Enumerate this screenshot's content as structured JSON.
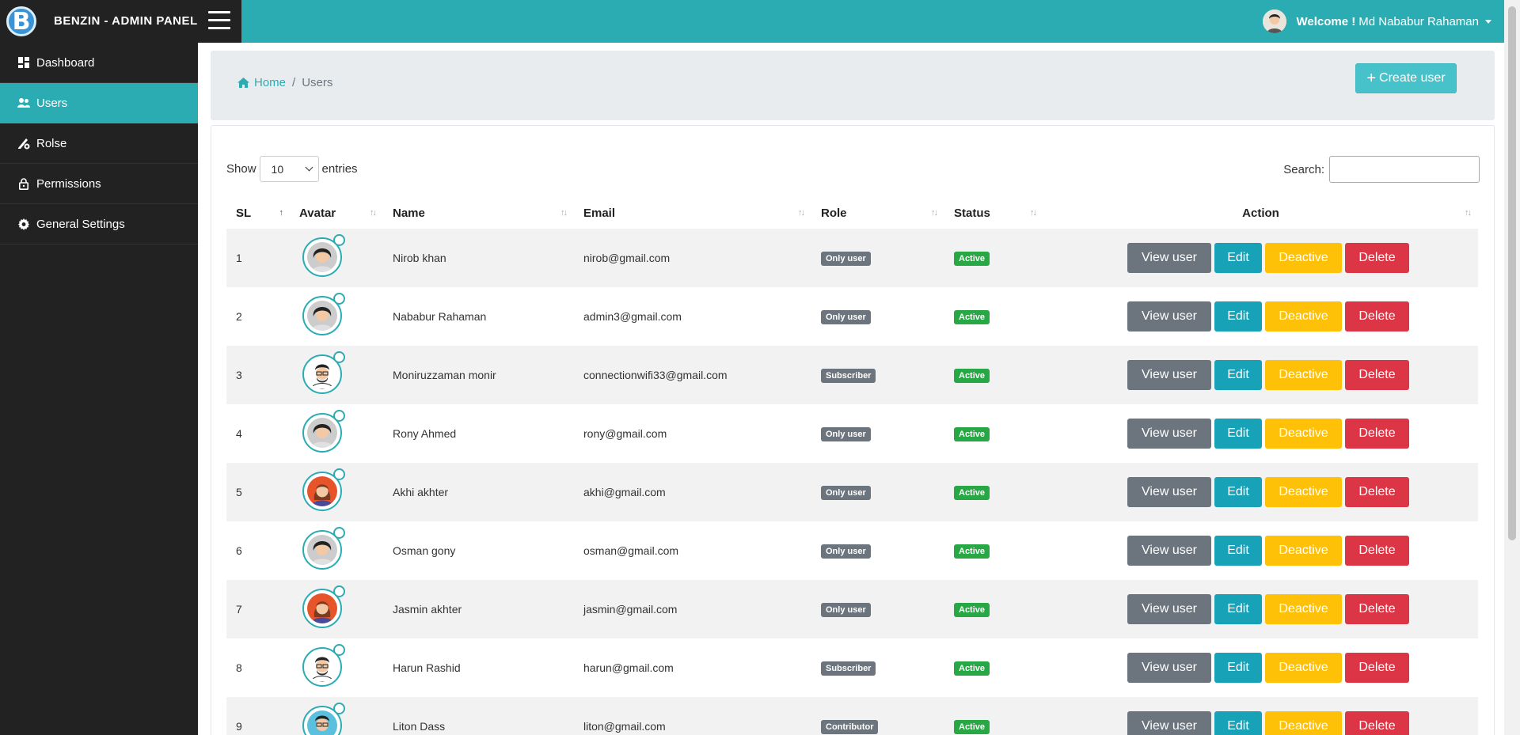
{
  "brand": {
    "logo_letter": "B",
    "title": "BENZIN - ADMIN PANEL"
  },
  "header": {
    "welcome_label": "Welcome !",
    "user_name": "Md Nababur Rahaman"
  },
  "sidebar": {
    "items": [
      {
        "label": "Dashboard",
        "icon": "dashboard-icon",
        "active": false
      },
      {
        "label": "Users",
        "icon": "users-icon",
        "active": true
      },
      {
        "label": "Rolse",
        "icon": "roles-icon",
        "active": false
      },
      {
        "label": "Permissions",
        "icon": "lock-icon",
        "active": false
      },
      {
        "label": "General Settings",
        "icon": "gear-icon",
        "active": false
      }
    ]
  },
  "breadcrumb": {
    "home": "Home",
    "separator": "/",
    "current": "Users"
  },
  "create_button": {
    "label": "Create user"
  },
  "table_controls": {
    "show_label": "Show",
    "entries_value": "10",
    "entries_label": "entries",
    "search_label": "Search:",
    "search_value": ""
  },
  "columns": [
    "SL",
    "Avatar",
    "Name",
    "Email",
    "Role",
    "Status",
    "Action"
  ],
  "actions": {
    "view": "View user",
    "edit": "Edit",
    "deactive": "Deactive",
    "delete": "Delete"
  },
  "rows": [
    {
      "sl": "1",
      "avatar": "male-dark",
      "name": "Nirob khan",
      "email": "nirob@gmail.com",
      "role": "Only user",
      "status": "Active"
    },
    {
      "sl": "2",
      "avatar": "male-dark",
      "name": "Nababur Rahaman",
      "email": "admin3@gmail.com",
      "role": "Only user",
      "status": "Active"
    },
    {
      "sl": "3",
      "avatar": "male-glasses",
      "name": "Moniruzzaman monir",
      "email": "connectionwifi33@gmail.com",
      "role": "Subscriber",
      "status": "Active"
    },
    {
      "sl": "4",
      "avatar": "male-dark",
      "name": "Rony Ahmed",
      "email": "rony@gmail.com",
      "role": "Only user",
      "status": "Active"
    },
    {
      "sl": "5",
      "avatar": "female",
      "name": "Akhi akhter",
      "email": "akhi@gmail.com",
      "role": "Only user",
      "status": "Active"
    },
    {
      "sl": "6",
      "avatar": "male-dark",
      "name": "Osman gony",
      "email": "osman@gmail.com",
      "role": "Only user",
      "status": "Active"
    },
    {
      "sl": "7",
      "avatar": "female",
      "name": "Jasmin akhter",
      "email": "jasmin@gmail.com",
      "role": "Only user",
      "status": "Active"
    },
    {
      "sl": "8",
      "avatar": "male-glasses",
      "name": "Harun Rashid",
      "email": "harun@gmail.com",
      "role": "Subscriber",
      "status": "Active"
    },
    {
      "sl": "9",
      "avatar": "male-blue",
      "name": "Liton Dass",
      "email": "liton@gmail.com",
      "role": "Contributor",
      "status": "Active"
    }
  ]
}
